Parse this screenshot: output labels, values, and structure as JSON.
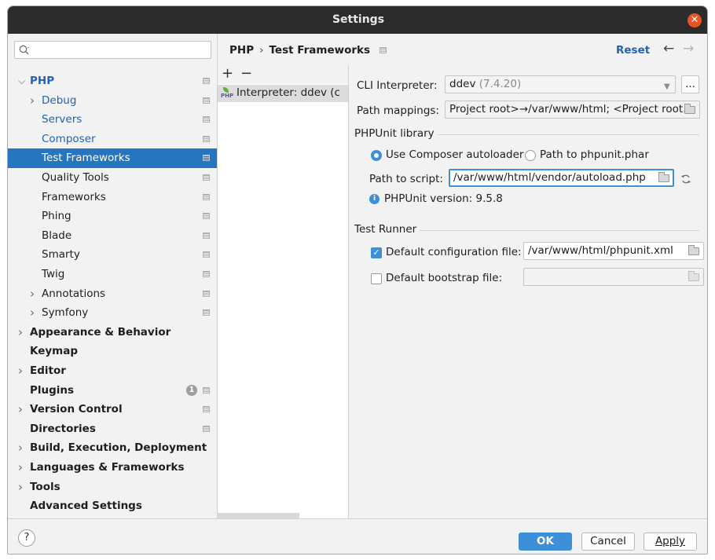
{
  "window": {
    "title": "Settings"
  },
  "search": {
    "placeholder": ""
  },
  "tree": [
    {
      "label": "PHP",
      "style": "link-bold",
      "expand": "open",
      "proj": true
    },
    {
      "label": "Debug",
      "style": "link",
      "expand": "closed",
      "proj": true
    },
    {
      "label": "Servers",
      "style": "link",
      "expand": "",
      "proj": true
    },
    {
      "label": "Composer",
      "style": "link",
      "expand": "",
      "proj": true
    },
    {
      "label": "Test Frameworks",
      "style": "selected",
      "expand": "",
      "proj": true
    },
    {
      "label": "Quality Tools",
      "style": "",
      "expand": "",
      "proj": true
    },
    {
      "label": "Frameworks",
      "style": "",
      "expand": "",
      "proj": true
    },
    {
      "label": "Phing",
      "style": "",
      "expand": "",
      "proj": true
    },
    {
      "label": "Blade",
      "style": "",
      "expand": "",
      "proj": true
    },
    {
      "label": "Smarty",
      "style": "",
      "expand": "",
      "proj": true
    },
    {
      "label": "Twig",
      "style": "",
      "expand": "",
      "proj": true
    },
    {
      "label": "Annotations",
      "style": "",
      "expand": "closed",
      "proj": true
    },
    {
      "label": "Symfony",
      "style": "",
      "expand": "closed",
      "proj": true
    },
    {
      "label": "Appearance & Behavior",
      "style": "bold",
      "expand": "closed",
      "proj": false
    },
    {
      "label": "Keymap",
      "style": "bold",
      "expand": "",
      "proj": false
    },
    {
      "label": "Editor",
      "style": "bold",
      "expand": "closed",
      "proj": false
    },
    {
      "label": "Plugins",
      "style": "bold",
      "expand": "",
      "proj": true,
      "badge": "1"
    },
    {
      "label": "Version Control",
      "style": "bold",
      "expand": "closed",
      "proj": true
    },
    {
      "label": "Directories",
      "style": "bold",
      "expand": "",
      "proj": true
    },
    {
      "label": "Build, Execution, Deployment",
      "style": "bold",
      "expand": "closed",
      "proj": false
    },
    {
      "label": "Languages & Frameworks",
      "style": "bold",
      "expand": "closed",
      "proj": false
    },
    {
      "label": "Tools",
      "style": "bold",
      "expand": "closed",
      "proj": false
    },
    {
      "label": "Advanced Settings",
      "style": "bold",
      "expand": "",
      "proj": false
    }
  ],
  "header": {
    "breadcrumb_parent": "PHP",
    "breadcrumb_sep": "›",
    "breadcrumb_current": "Test Frameworks",
    "reset_label": "Reset",
    "back_icon": "←",
    "forward_icon": "→"
  },
  "interpreters": {
    "add_icon": "+",
    "remove_icon": "−",
    "item_label": "Interpreter: ddev (c"
  },
  "form": {
    "cli_label": "CLI Interpreter:",
    "cli_value": "ddev",
    "cli_version": "(7.4.20)",
    "more_label": "...",
    "mappings_label": "Path mappings:",
    "mappings_value": "Project root>→/var/www/html; <Project root...",
    "phpunit_section": "PHPUnit library",
    "radio_composer": "Use Composer autoloader",
    "radio_phar": "Path to phpunit.phar",
    "script_label": "Path to script:",
    "script_value": "/var/www/html/vendor/autoload.php",
    "version_text": "PHPUnit version: 9.5.8",
    "runner_section": "Test Runner",
    "config_label": "Default configuration file:",
    "config_value": "/var/www/html/phpunit.xml",
    "bootstrap_label": "Default bootstrap file:",
    "bootstrap_value": ""
  },
  "footer": {
    "help_label": "?",
    "ok_label": "OK",
    "cancel_label": "Cancel",
    "apply_label": "Apply"
  },
  "colors": {
    "accent": "#3d8fd8",
    "selection": "#2675bf",
    "link": "#2162b5",
    "close_button": "#e95420"
  }
}
